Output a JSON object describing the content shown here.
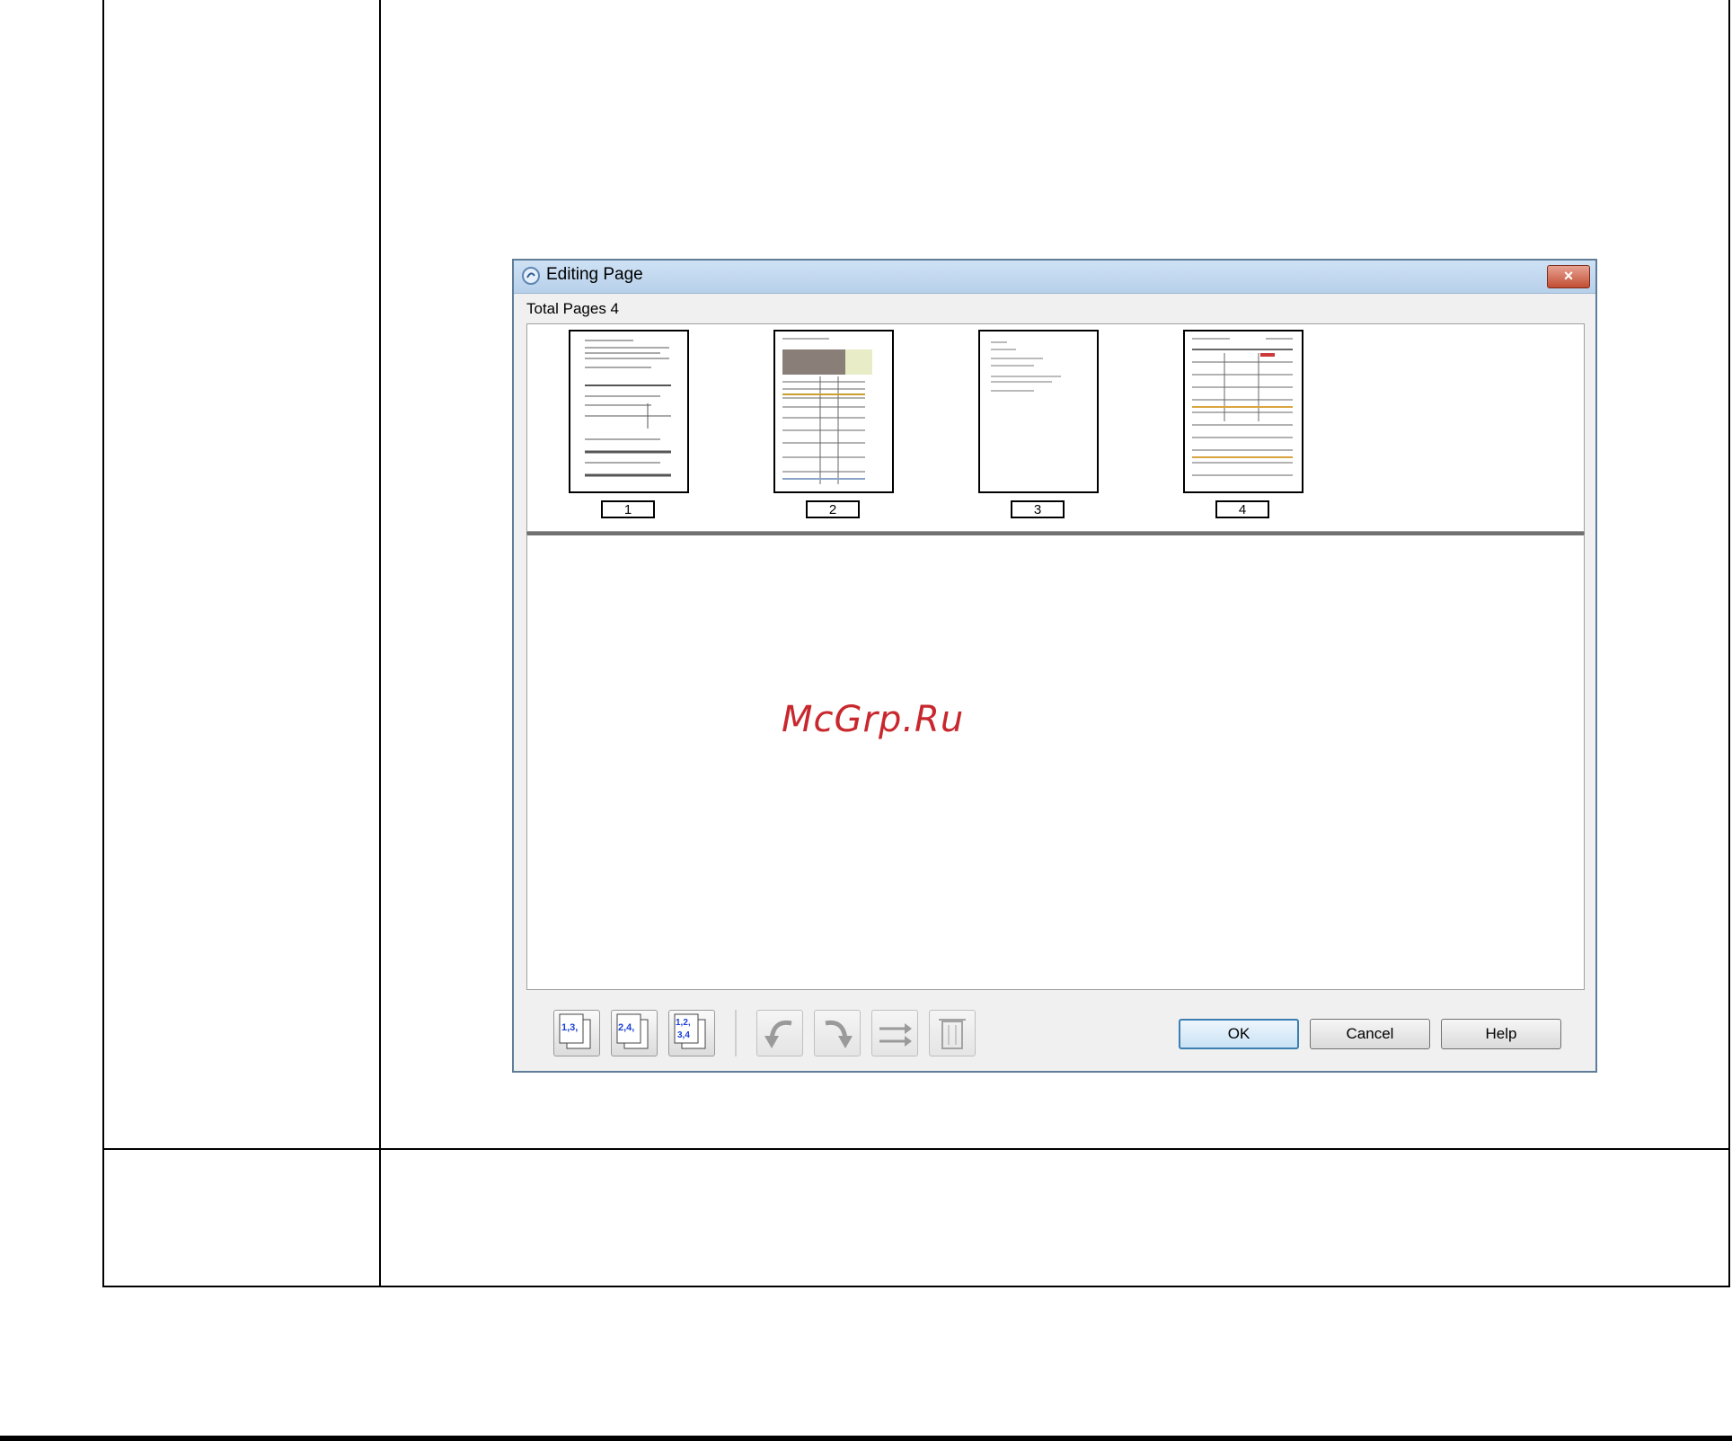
{
  "watermark": "McGrp.Ru",
  "dialog": {
    "title": "Editing Page",
    "close_label": "×",
    "total_pages_label": "Total Pages 4",
    "pages": [
      "1",
      "2",
      "3",
      "4"
    ],
    "toolbar": {
      "icons": [
        "odd-pages-icon",
        "even-pages-icon",
        "all-pages-icon",
        "rotate-left-icon",
        "rotate-right-icon",
        "page-order-icon",
        "delete-icon"
      ]
    },
    "buttons": {
      "ok": "OK",
      "cancel": "Cancel",
      "help": "Help"
    }
  }
}
